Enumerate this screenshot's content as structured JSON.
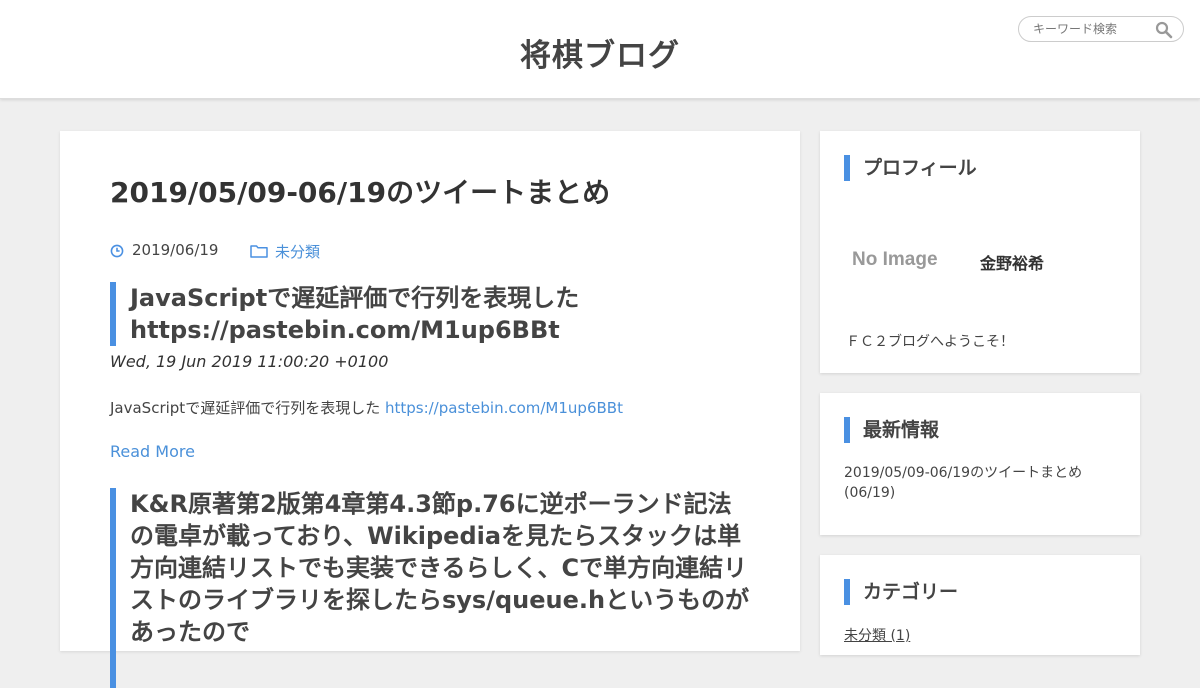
{
  "header": {
    "site_title": "将棋ブログ",
    "search_placeholder": "キーワード検索"
  },
  "article": {
    "title": "2019/05/09-06/19のツイートまとめ",
    "date": "2019/06/19",
    "category": "未分類"
  },
  "tweets": [
    {
      "heading": "JavaScriptで遅延評価で行列を表現した https://pastebin.com/M1up6BBt",
      "date": "Wed, 19 Jun 2019 11:00:20 +0100",
      "body_text": "JavaScriptで遅延評価で行列を表現した ",
      "body_link": "https://pastebin.com/M1up6BBt",
      "read_more": "Read More"
    },
    {
      "heading": "K&R原著第2版第4章第4.3節p.76に逆ポーランド記法の電卓が載っており、Wikipediaを見たらスタックは単方向連結リストでも実装できるらしく、Cで単方向連結リストのライブラリを探したらsys/queue.hというものがあったので"
    }
  ],
  "sidebar": {
    "profile": {
      "heading": "プロフィール",
      "image_text": "No Image",
      "name": "金野裕希",
      "text": "ＦＣ２ブログへようこそ！"
    },
    "latest": {
      "heading": "最新情報",
      "entry": "2019/05/09-06/19のツイートまとめ (06/19)"
    },
    "categories": {
      "heading": "カテゴリー",
      "item": "未分類 (1)"
    }
  }
}
